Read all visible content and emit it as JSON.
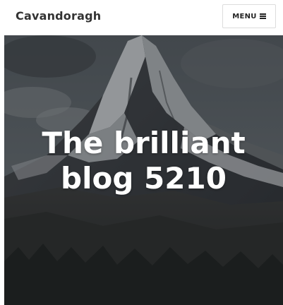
{
  "header": {
    "site_title": "Cavandoragh",
    "menu_label": "MENU"
  },
  "icons": {
    "menu": "hamburger-icon"
  },
  "hero": {
    "title_line1": "The brilliant",
    "title_line2": "blog 5210"
  },
  "colors": {
    "header_bg": "#ffffff",
    "title_text": "#333333",
    "hero_text": "#ffffff",
    "menu_border": "#dcdcdc"
  }
}
